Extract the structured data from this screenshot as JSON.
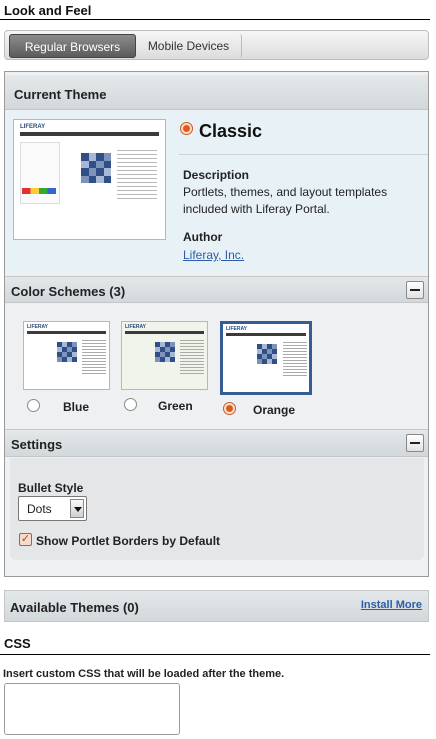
{
  "page": {
    "title": "Look and Feel"
  },
  "tabs": [
    {
      "label": "Regular Browsers",
      "active": true
    },
    {
      "label": "Mobile Devices",
      "active": false
    }
  ],
  "current_theme": {
    "header": "Current Theme",
    "name": "Classic",
    "description_label": "Description",
    "description": "Portlets, themes, and layout templates included with Liferay Portal.",
    "author_label": "Author",
    "author": "Liferay, Inc.",
    "logo_text": "LIFERAY"
  },
  "color_schemes": {
    "header": "Color Schemes (3)",
    "items": [
      {
        "name": "Blue",
        "selected": false,
        "color": "#1d3d73"
      },
      {
        "name": "Green",
        "selected": false,
        "color": "#1d3d73"
      },
      {
        "name": "Orange",
        "selected": true,
        "color": "#1d3d73"
      }
    ]
  },
  "settings": {
    "header": "Settings",
    "bullet_label": "Bullet Style",
    "bullet_value": "Dots",
    "borders_label": "Show Portlet Borders by Default",
    "borders_checked": true
  },
  "available_themes": {
    "header": "Available Themes (0)",
    "install_more": "Install More"
  },
  "css": {
    "title": "CSS",
    "instruction": "Insert custom CSS that will be loaded after the theme.",
    "value": ""
  },
  "colors": {
    "accent": "#e05a17",
    "link": "#2b5eaa",
    "selected_border": "#355d94"
  }
}
